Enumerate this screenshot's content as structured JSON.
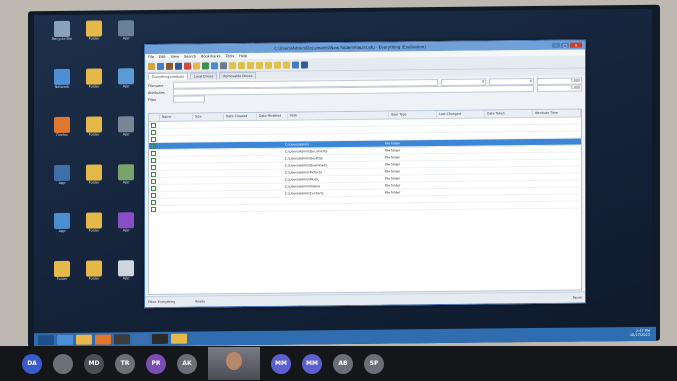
{
  "window": {
    "title": "C:\\Users\\Admin\\Documents\\New folder\\FileList.efu - Everything (Evaluation)",
    "menu": [
      "File",
      "Edit",
      "View",
      "Search",
      "Bookmarks",
      "Tools",
      "Help"
    ],
    "tabs": [
      "Everything (default)",
      "Local Drives",
      "Removable Drives"
    ],
    "filters": {
      "row1_label": "Filename",
      "row2_label": "Attributes",
      "row3_label": "Filter",
      "num1": "0",
      "num2": "0",
      "num3": "1,000",
      "num4": "1,000"
    },
    "columns": [
      "Name",
      "Size",
      "Date Created",
      "Date Modified",
      "Path",
      "Item Type",
      "Last Changed",
      "Date Taken",
      "Attribute Time"
    ],
    "rows": [
      {
        "name": "",
        "path": "",
        "type": "",
        "extra": "",
        "selected": false
      },
      {
        "name": "",
        "path": "",
        "type": "",
        "extra": "",
        "selected": false
      },
      {
        "name": "",
        "path": "",
        "type": "",
        "extra": "",
        "selected": false
      },
      {
        "name": "",
        "path": "C:\\Users\\Admin",
        "type": "File folder",
        "extra": "",
        "selected": true
      },
      {
        "name": "",
        "path": "C:\\Users\\Admin\\Documents",
        "type": "File folder",
        "extra": "",
        "selected": false
      },
      {
        "name": "",
        "path": "C:\\Users\\Admin\\Desktop",
        "type": "File folder",
        "extra": "",
        "selected": false
      },
      {
        "name": "",
        "path": "C:\\Users\\Admin\\Downloads",
        "type": "File folder",
        "extra": "",
        "selected": false
      },
      {
        "name": "",
        "path": "C:\\Users\\Admin\\Pictures",
        "type": "File folder",
        "extra": "",
        "selected": false
      },
      {
        "name": "",
        "path": "C:\\Users\\Admin\\Music",
        "type": "File folder",
        "extra": "",
        "selected": false
      },
      {
        "name": "",
        "path": "C:\\Users\\Admin\\Videos",
        "type": "File folder",
        "extra": "",
        "selected": false
      },
      {
        "name": "",
        "path": "C:\\Users\\Admin\\Contacts",
        "type": "File folder",
        "extra": "",
        "selected": false
      },
      {
        "name": "",
        "path": "",
        "type": "",
        "extra": "",
        "selected": false
      },
      {
        "name": "",
        "path": "",
        "type": "",
        "extra": "",
        "selected": false
      }
    ],
    "status": {
      "left": "Filter: Everything",
      "middle": "Ready",
      "right": "Pause"
    }
  },
  "desktop_icons": [
    {
      "label": "Recycle Bin",
      "color": "#8aa2bd"
    },
    {
      "label": "Folder",
      "color": "#e5b84a"
    },
    {
      "label": "App",
      "color": "#6a7f9a"
    },
    {
      "label": "Network",
      "color": "#4e8fd6"
    },
    {
      "label": "Folder",
      "color": "#e5b84a"
    },
    {
      "label": "App",
      "color": "#5b9bd5"
    },
    {
      "label": "Firefox",
      "color": "#e0762f"
    },
    {
      "label": "Folder",
      "color": "#e5b84a"
    },
    {
      "label": "App",
      "color": "#7a8596"
    },
    {
      "label": "App",
      "color": "#3e6fa8"
    },
    {
      "label": "Folder",
      "color": "#e5b84a"
    },
    {
      "label": "App",
      "color": "#7aa26b"
    },
    {
      "label": "App",
      "color": "#4a8ed0"
    },
    {
      "label": "Folder",
      "color": "#e5b84a"
    },
    {
      "label": "App",
      "color": "#8a4fc7"
    },
    {
      "label": "Folder",
      "color": "#e5b84a"
    },
    {
      "label": "Folder",
      "color": "#e5b84a"
    },
    {
      "label": "App",
      "color": "#cfd6e0"
    }
  ],
  "taskbar": {
    "items": [
      "#4c8fd8",
      "#e8b64c",
      "#e0762f",
      "#3b3b3b",
      "#3b6fb0",
      "#2b2b2b",
      "#e5b84a"
    ],
    "time": "2:47 PM",
    "date": "10/17/2023"
  },
  "participants": [
    {
      "initials": "DA",
      "color": "#3a5bcc",
      "name": ""
    },
    {
      "initials": "",
      "color": "#6b6f76",
      "name": ""
    },
    {
      "initials": "MD",
      "color": "#4a4e55",
      "name": ""
    },
    {
      "initials": "TR",
      "color": "#6b6f76",
      "name": ""
    },
    {
      "initials": "PR",
      "color": "#7a4fb5",
      "name": ""
    },
    {
      "initials": "AK",
      "color": "#6b6f76",
      "name": ""
    },
    {
      "initials": "MM",
      "color": "#5b5fd0",
      "name": ""
    },
    {
      "initials": "MM",
      "color": "#5b5fd0",
      "name": ""
    },
    {
      "initials": "AB",
      "color": "#6b6f76",
      "name": ""
    },
    {
      "initials": "SP",
      "color": "#6b6f76",
      "name": ""
    }
  ],
  "colors": {
    "accent": "#3d86d6",
    "taskbar": "#2f6db0"
  }
}
